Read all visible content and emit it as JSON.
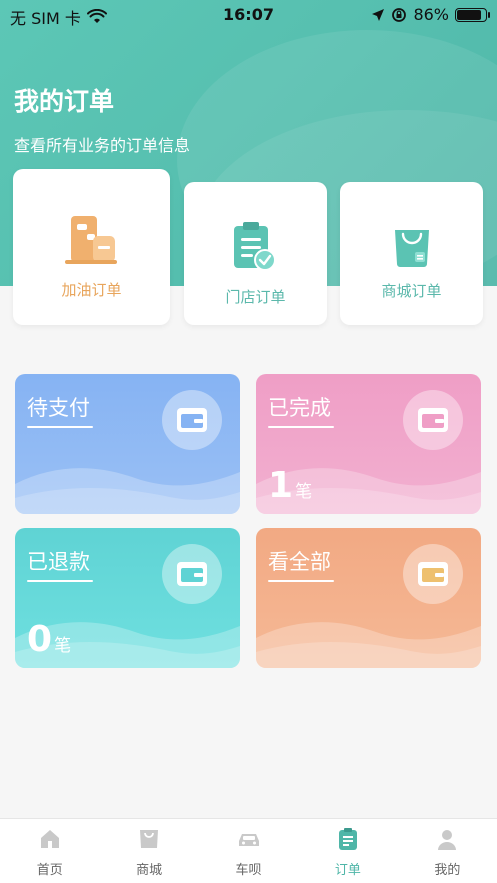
{
  "status_bar": {
    "carrier": "无 SIM 卡",
    "time": "16:07",
    "battery": "86%",
    "battery_level": 0.86
  },
  "header": {
    "title": "我的订单",
    "subtitle": "查看所有业务的订单信息"
  },
  "order_types": [
    {
      "label": "加油订单",
      "icon": "fuel-store-icon",
      "color": "#e8a55c"
    },
    {
      "label": "门店订单",
      "icon": "clipboard-check-icon",
      "color": "#5bb8ab"
    },
    {
      "label": "商城订单",
      "icon": "shopping-bag-icon",
      "color": "#5bb8ab"
    }
  ],
  "order_status": [
    {
      "title": "待支付",
      "icon": "wallet-icon",
      "color": "#86b3f3"
    },
    {
      "title": "已完成",
      "count": "1",
      "unit": "笔",
      "icon": "wallet-icon",
      "color": "#ef9ec6"
    },
    {
      "title": "已退款",
      "count": "0",
      "unit": "笔",
      "icon": "wallet-icon",
      "color": "#5fd3d4"
    },
    {
      "title": "看全部",
      "icon": "wallet-icon",
      "color": "#f2a983"
    }
  ],
  "tabbar": {
    "items": [
      {
        "label": "首页",
        "icon": "home-icon"
      },
      {
        "label": "商城",
        "icon": "bag-icon"
      },
      {
        "label": "车呗",
        "icon": "car-icon"
      },
      {
        "label": "订单",
        "icon": "order-icon",
        "active": true
      },
      {
        "label": "我的",
        "icon": "user-icon"
      }
    ]
  },
  "colors": {
    "accent": "#4fb6a8",
    "header": "#5cc7b6"
  }
}
